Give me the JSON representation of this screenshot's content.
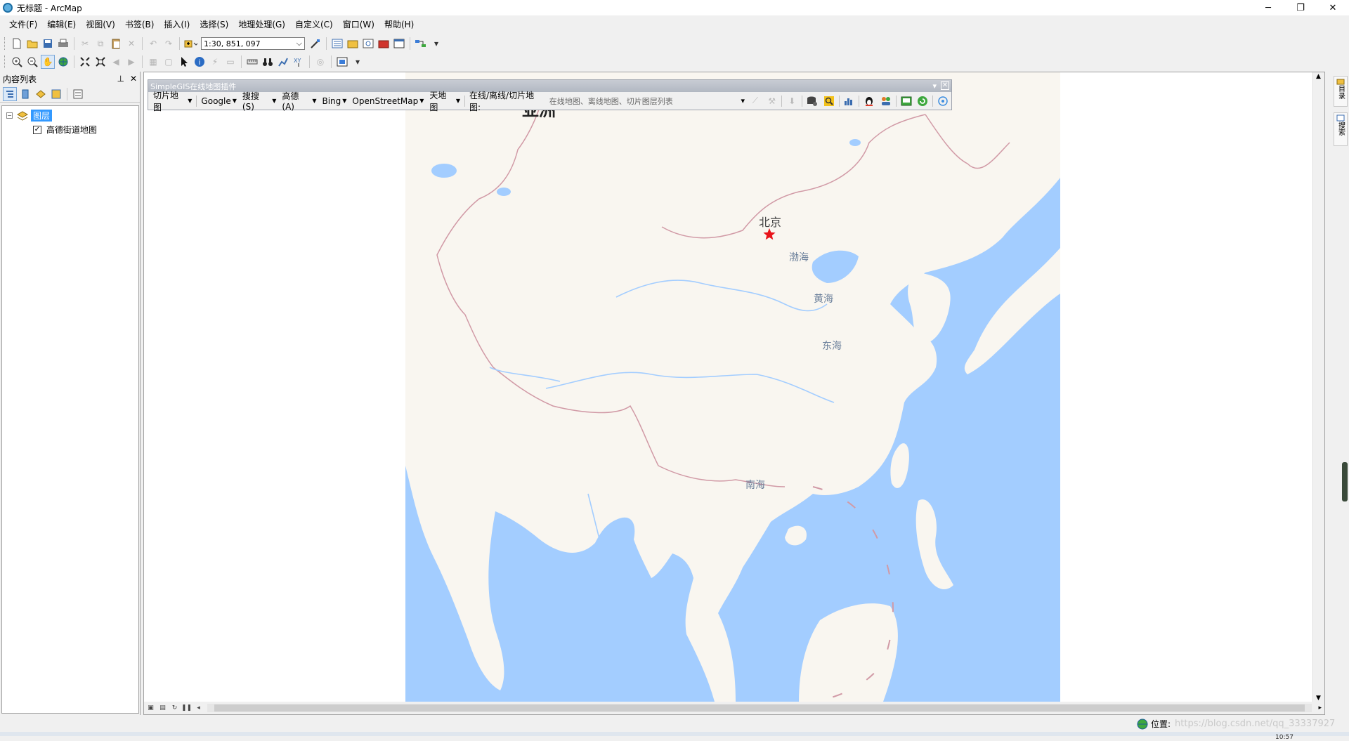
{
  "window": {
    "title": "无标题 - ArcMap",
    "minimize": "─",
    "restore": "❐",
    "close": "✕"
  },
  "menu": [
    "文件(F)",
    "编辑(E)",
    "视图(V)",
    "书签(B)",
    "插入(I)",
    "选择(S)",
    "地理处理(G)",
    "自定义(C)",
    "窗口(W)",
    "帮助(H)"
  ],
  "toolbar": {
    "scale": "1:30, 851, 097",
    "scale_arrow": "⌵"
  },
  "toc": {
    "title": "内容列表",
    "pin": "⊥",
    "close": "✕",
    "group_expander": "−",
    "group_label": "图层",
    "layer_checked": "✓",
    "layer_name": "高德街道地图"
  },
  "plugin": {
    "title": "SimpleGIS在线地图插件",
    "menu_arrow": "▾",
    "close": "✕",
    "dropdowns": [
      "切片地图",
      "Google",
      "搜搜(S)",
      "高德(A)",
      "Bing",
      "OpenStreetMap",
      "天地图"
    ],
    "combo_label": "在线/离线/切片地图:",
    "combo_value": "在线地图、离线地图、切片图层列表",
    "combo_arrow": "▾"
  },
  "map": {
    "continent": "亚洲",
    "capital": "北京",
    "bohai": "渤海",
    "yellow_sea": "黄海",
    "east_sea": "东海",
    "south_sea": "南海",
    "land_color": "#f9f6f0",
    "sea_color": "#a3cdff",
    "border_color": "#d19aa6",
    "star_color": "#e8141a"
  },
  "dock": {
    "tab1": "目录",
    "tab2": "搜索"
  },
  "status": {
    "position_label": "位置:",
    "watermark": "https://blog.csdn.net/qq_33337927",
    "time": "10:57"
  }
}
